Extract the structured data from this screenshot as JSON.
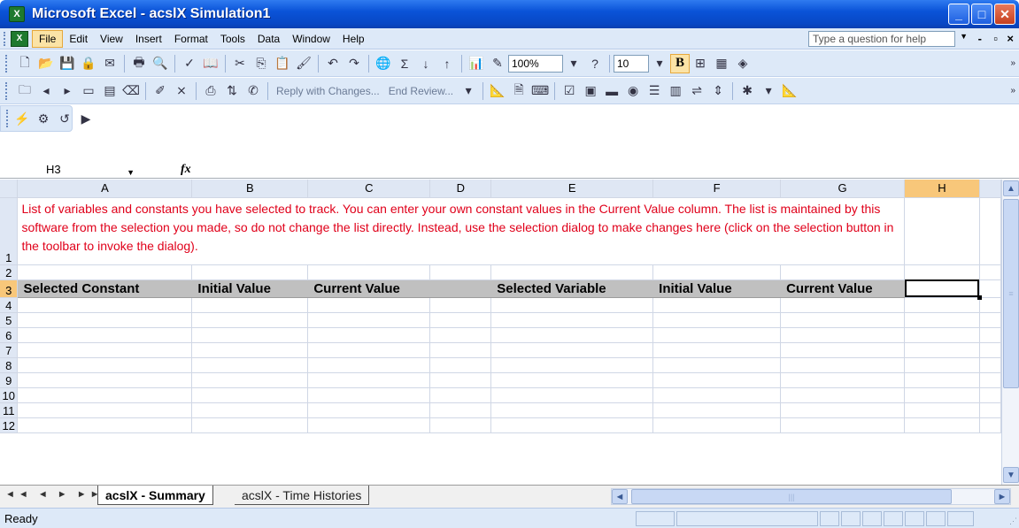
{
  "window": {
    "title": "Microsoft Excel - acslX Simulation1",
    "app_icon": "excel-icon",
    "controls": [
      "_",
      "□",
      "X"
    ]
  },
  "menubar": {
    "items": [
      "File",
      "Edit",
      "View",
      "Insert",
      "Format",
      "Tools",
      "Data",
      "Window",
      "Help"
    ],
    "help_placeholder": "Type a question for help",
    "doc_controls": [
      "-",
      "▫",
      "×"
    ]
  },
  "toolbar_standard": {
    "zoom": "100%",
    "font_size": "10",
    "bold_label": "B"
  },
  "toolbar_review": {
    "reply_label": "Reply with Changes...",
    "end_review_label": "End Review..."
  },
  "formula_bar": {
    "name_box": "H3",
    "fx_label": "fx",
    "content": ""
  },
  "sheet": {
    "columns": [
      "A",
      "B",
      "C",
      "D",
      "E",
      "F",
      "G",
      "H"
    ],
    "selected_column": "H",
    "rows": [
      "1",
      "2",
      "3",
      "4",
      "5",
      "6",
      "7",
      "8",
      "9",
      "10",
      "11",
      "12"
    ],
    "selected_row": "3",
    "note": "List of variables and constants you have selected to track. You can enter your own constant values in the Current Value column. The list is maintained by this software from the selection you made, so do not change the list directly. Instead, use the selection dialog to make changes here (click on the selection button in the toolbar to invoke the dialog).",
    "headers": {
      "a": "Selected Constant",
      "b": "Initial Value",
      "c": "Current Value",
      "d": "",
      "e": "Selected Variable",
      "f": "Initial Value",
      "g": "Current Value"
    },
    "active_cell": "H3"
  },
  "tabs": {
    "nav": "◄◄ ◄ ► ►►",
    "items": [
      "acslX - Summary",
      "acslX - Time Histories"
    ],
    "active": "acslX - Summary"
  },
  "statusbar": {
    "text": "Ready"
  },
  "colors": {
    "title_bar": "#0a53d8",
    "note_text": "#e0001a",
    "header_row_bg": "#c0c0c0",
    "selected_header": "#f8c77a"
  }
}
